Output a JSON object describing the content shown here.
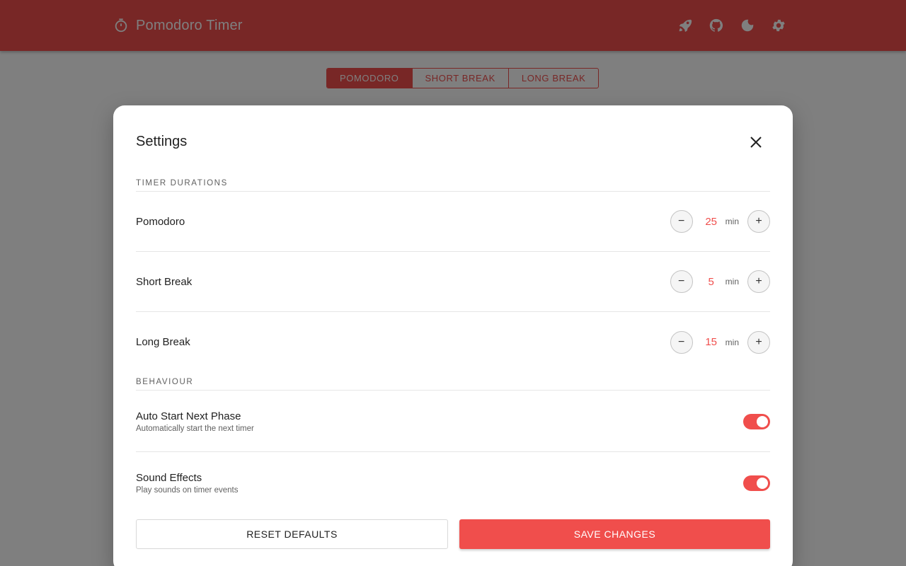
{
  "app": {
    "title": "Pomodoro Timer",
    "brand_icon": "timer-icon",
    "actions": [
      {
        "name": "rocket-icon",
        "label": "rocket"
      },
      {
        "name": "github-icon",
        "label": "github"
      },
      {
        "name": "moon-icon",
        "label": "dark mode"
      },
      {
        "name": "gear-icon",
        "label": "settings"
      }
    ]
  },
  "mode_tabs": [
    {
      "label": "POMODORO",
      "active": true
    },
    {
      "label": "SHORT BREAK",
      "active": false
    },
    {
      "label": "LONG BREAK",
      "active": false
    }
  ],
  "settings": {
    "title": "Settings",
    "durations_label": "TIMER DURATIONS",
    "durations": [
      {
        "label": "Pomodoro",
        "value": "25",
        "unit": "min",
        "decrement": "−",
        "increment": "+"
      },
      {
        "label": "Short Break",
        "value": "5",
        "unit": "min",
        "decrement": "−",
        "increment": "+"
      },
      {
        "label": "Long Break",
        "value": "15",
        "unit": "min",
        "decrement": "−",
        "increment": "+"
      }
    ],
    "behaviour_label": "BEHAVIOUR",
    "behaviour": [
      {
        "title": "Auto Start Next Phase",
        "description": "Automatically start the next timer",
        "enabled": true
      },
      {
        "title": "Sound Effects",
        "description": "Play sounds on timer events",
        "enabled": true
      }
    ],
    "reset_label": "RESET DEFAULTS",
    "save_label": "SAVE CHANGES"
  },
  "colors": {
    "accent": "#f04e4c",
    "overlay": "rgba(0,0,0,0.5)"
  }
}
